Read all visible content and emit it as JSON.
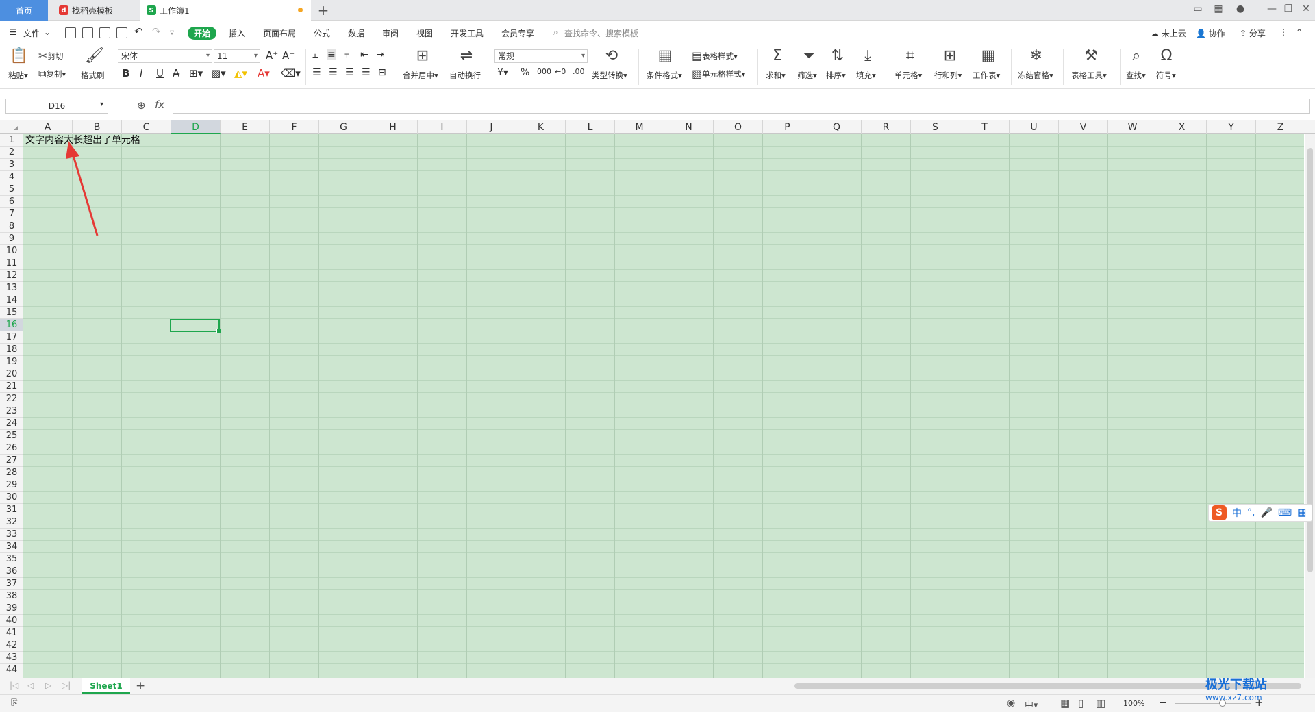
{
  "tabs": [
    {
      "label": "首页"
    },
    {
      "label": "找稻壳模板"
    },
    {
      "label": "工作簿1"
    }
  ],
  "menus": [
    "文件",
    "开始",
    "插入",
    "页面布局",
    "公式",
    "数据",
    "审阅",
    "视图",
    "开发工具",
    "会员专享"
  ],
  "search_placeholder": "查找命令、搜索模板",
  "right_actions": [
    "未上云",
    "协作",
    "分享"
  ],
  "toolbar": {
    "paste": "粘贴",
    "cut": "剪切",
    "copy": "复制",
    "format_painter": "格式刷",
    "font": "宋体",
    "font_size": "11",
    "merge": "合并居中",
    "wrap": "自动换行",
    "number_format": "常规",
    "type_convert": "类型转换",
    "cond_format": "条件格式",
    "table_style": "表格样式",
    "cell_style": "单元格样式",
    "sum": "求和",
    "filter": "筛选",
    "sort": "排序",
    "fill": "填充",
    "cell": "单元格",
    "rowcol": "行和列",
    "sheet": "工作表",
    "freeze": "冻结窗格",
    "table_tools": "表格工具",
    "find": "查找",
    "symbol": "符号"
  },
  "name_box": "D16",
  "fx_label": "fx",
  "columns": [
    "A",
    "B",
    "C",
    "D",
    "E",
    "F",
    "G",
    "H",
    "I",
    "J",
    "K",
    "L",
    "M",
    "N",
    "O",
    "P",
    "Q",
    "R",
    "S",
    "T",
    "U",
    "V",
    "W",
    "X",
    "Y",
    "Z"
  ],
  "rows": [
    "1",
    "2",
    "3",
    "4",
    "5",
    "6",
    "7",
    "8",
    "9",
    "10",
    "11",
    "12",
    "13",
    "14",
    "15",
    "16",
    "17",
    "18",
    "19",
    "20",
    "21",
    "22",
    "23",
    "24",
    "25",
    "26",
    "27",
    "28",
    "29",
    "30",
    "31",
    "32",
    "33",
    "34",
    "35",
    "36",
    "37",
    "38",
    "39",
    "40",
    "41",
    "42",
    "43",
    "44"
  ],
  "active_col": "D",
  "active_row": "16",
  "cell_a1": "文字内容太长超出了单元格",
  "sheet_tab": "Sheet1",
  "zoom": "100%",
  "ime": {
    "lang": "中"
  },
  "watermark": {
    "title": "极光下载站",
    "url": "www.xz7.com"
  },
  "colors": {
    "accent": "#1ea64d",
    "grid_bg": "#cde6d0",
    "arrow": "#e53935"
  }
}
